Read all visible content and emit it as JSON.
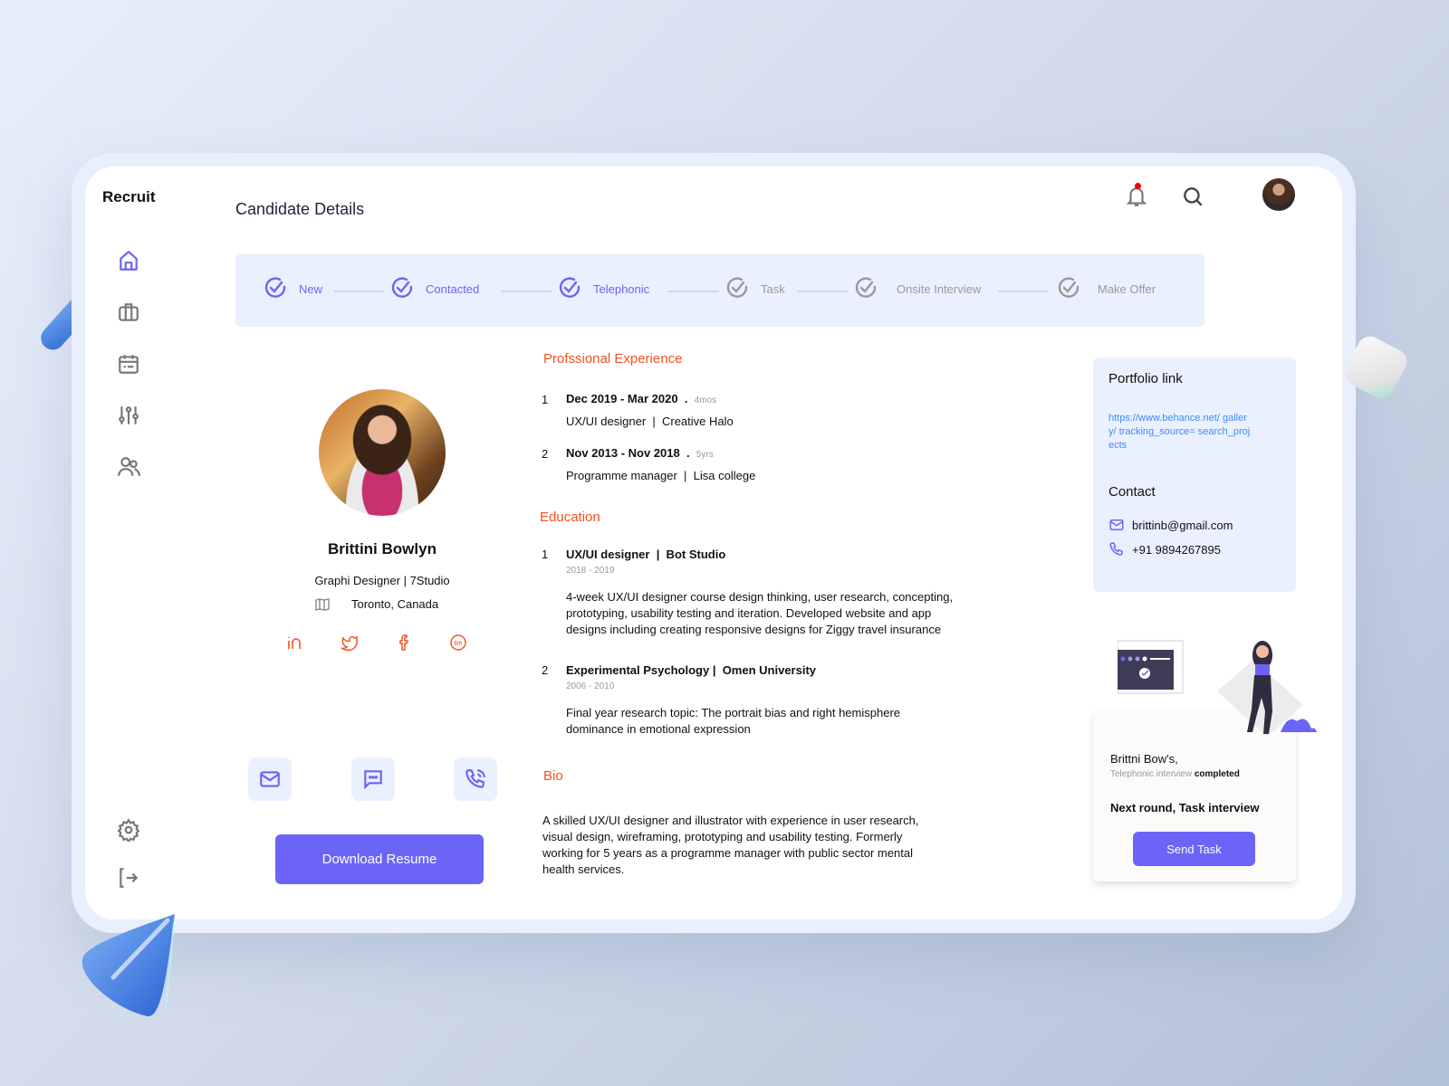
{
  "app": {
    "brand": "Recruit",
    "page_title": "Candidate Details"
  },
  "colors": {
    "accent": "#6b64f6",
    "section_title": "#f4511e",
    "link": "#3f8cf6",
    "notification_dot": "#f40000",
    "card_bg": "#eaf0fe"
  },
  "sidebar": {
    "items": [
      {
        "name": "home",
        "icon": "home-icon",
        "active": true
      },
      {
        "name": "jobs",
        "icon": "briefcase-icon",
        "active": false
      },
      {
        "name": "calendar",
        "icon": "calendar-icon",
        "active": false
      },
      {
        "name": "filters",
        "icon": "sliders-icon",
        "active": false
      },
      {
        "name": "candidates",
        "icon": "users-icon",
        "active": false
      }
    ],
    "bottom": [
      {
        "name": "settings",
        "icon": "gear-icon"
      },
      {
        "name": "logout",
        "icon": "logout-icon"
      }
    ]
  },
  "header": {
    "notifications_icon": "bell-icon",
    "has_unread": true,
    "search_icon": "search-icon",
    "avatar": "user-avatar"
  },
  "pipeline": {
    "steps": [
      {
        "label": "New",
        "done": true
      },
      {
        "label": "Contacted",
        "done": true
      },
      {
        "label": "Telephonic",
        "done": true
      },
      {
        "label": "Task",
        "done": false
      },
      {
        "label": "Onsite Interview",
        "done": false
      },
      {
        "label": "Make Offer",
        "done": false
      }
    ]
  },
  "candidate": {
    "name": "Brittini Bowlyn",
    "role": "Graphi Designer | 7Studio",
    "location": "Toronto, Canada",
    "socials": [
      "linkedin-icon",
      "twitter-icon",
      "facebook-icon",
      "behance-icon"
    ],
    "actions": [
      "email-icon",
      "chat-icon",
      "phone-call-icon"
    ],
    "download_label": "Download Resume"
  },
  "experience": {
    "title": "Profssional Experience",
    "items": [
      {
        "num": "1",
        "dates": "Dec 2019 - Mar 2020",
        "duration": "4mos",
        "position": "UX/UI designer  |  Creative Halo"
      },
      {
        "num": "2",
        "dates": "Nov 2013 - Nov 2018",
        "duration": "5yrs",
        "position": "Programme manager  |  Lisa college"
      }
    ]
  },
  "education": {
    "title": "Education",
    "items": [
      {
        "num": "1",
        "title": "UX/UI designer  |  Bot Studio",
        "years": "2018 - 2019",
        "desc": "4-week UX/UI designer course design thinking, user research, concepting, prototyping, usability testing and iteration. Developed website and app designs including creating responsive designs for Ziggy travel insurance"
      },
      {
        "num": "2",
        "title": "Experimental Psychology |  Omen University",
        "years": "2006 - 2010",
        "desc": "Final year research topic: The portrait bias and right hemisphere dominance in emotional expression"
      }
    ]
  },
  "bio": {
    "title": "Bio",
    "text": "A skilled UX/UI designer and illustrator with experience in user research, visual design, wireframing, prototyping and usability testing. Formerly working for 5 years as a programme manager with public sector mental health services."
  },
  "portfolio": {
    "title": "Portfolio link",
    "url": "https://www.behance.net/ gallery/ tracking_source= search_projects"
  },
  "contact": {
    "title": "Contact",
    "email": "brittinb@gmail.com",
    "phone": "+91 9894267895"
  },
  "status_card": {
    "name_line": "Brittni Bow's,",
    "status_prefix": "Telephonic interview",
    "status_word": "completed",
    "next_round": "Next round, Task interview",
    "button": "Send Task"
  }
}
